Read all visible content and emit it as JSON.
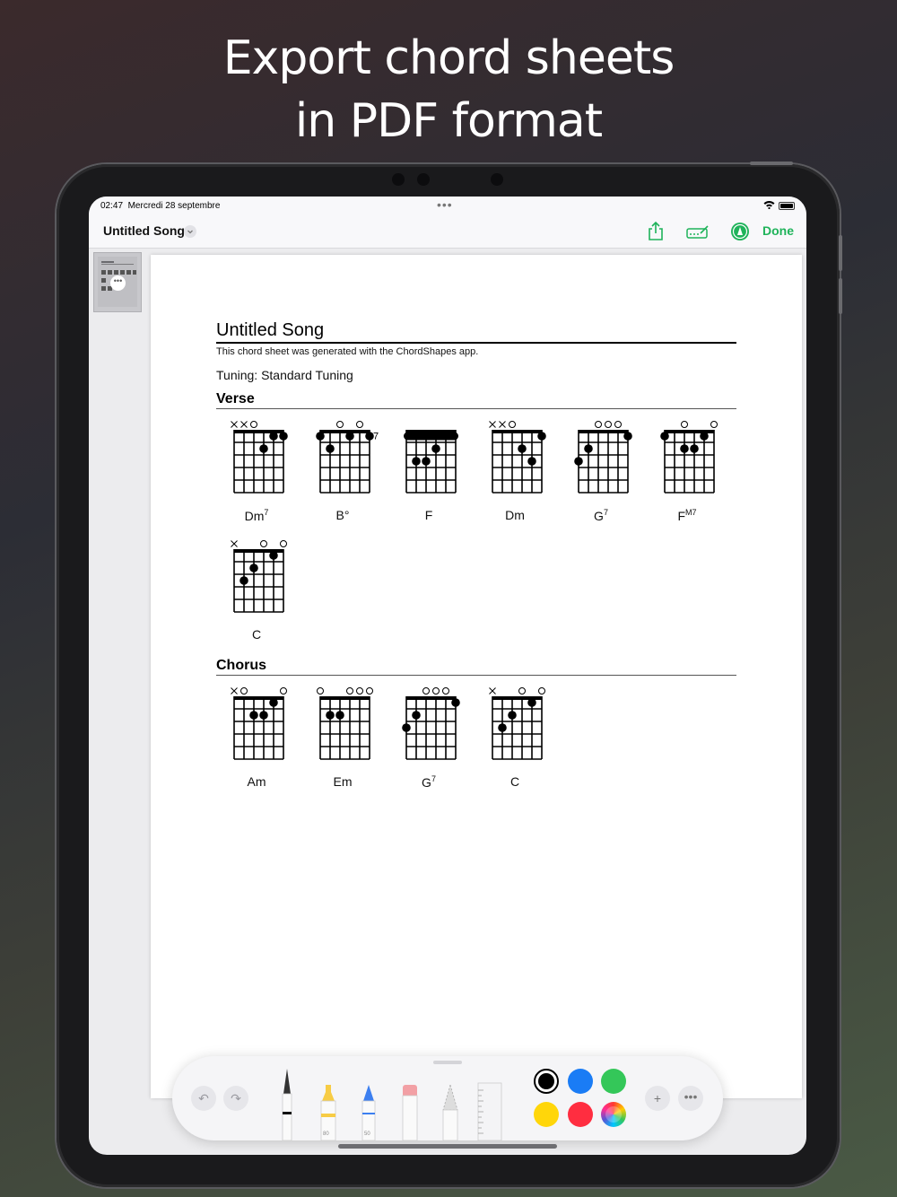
{
  "headline": {
    "line1": "Export chord sheets",
    "line2": "in PDF format"
  },
  "status_bar": {
    "time": "02:47",
    "date": "Mercredi 28 septembre"
  },
  "nav": {
    "title": "Untitled Song",
    "done_label": "Done"
  },
  "document": {
    "title": "Untitled Song",
    "subtitle": "This chord sheet was generated with the ChordShapes app.",
    "tuning": "Tuning: Standard Tuning",
    "sections": [
      {
        "label": "Verse",
        "chords": [
          {
            "base": "Dm",
            "sup": "7",
            "markers": [
              "x",
              "x",
              "o",
              "",
              "",
              ""
            ],
            "dots": [
              [
                3,
                2
              ],
              [
                4,
                1
              ],
              [
                5,
                1
              ]
            ]
          },
          {
            "base": "B°",
            "sup": "",
            "markers": [
              "",
              "",
              "o",
              "",
              "o",
              ""
            ],
            "fret_label": "7",
            "dots": [
              [
                0,
                1
              ],
              [
                1,
                2
              ],
              [
                3,
                1
              ],
              [
                5,
                1
              ]
            ]
          },
          {
            "base": "F",
            "sup": "",
            "markers": [
              "",
              "",
              "",
              "",
              "",
              ""
            ],
            "barre": 1,
            "dots": [
              [
                1,
                3
              ],
              [
                2,
                3
              ],
              [
                3,
                2
              ]
            ]
          },
          {
            "base": "Dm",
            "sup": "",
            "markers": [
              "x",
              "x",
              "o",
              "",
              "",
              ""
            ],
            "dots": [
              [
                3,
                2
              ],
              [
                4,
                3
              ],
              [
                5,
                1
              ]
            ]
          },
          {
            "base": "G",
            "sup": "7",
            "markers": [
              "",
              "",
              "o",
              "o",
              "o",
              ""
            ],
            "dots": [
              [
                0,
                3
              ],
              [
                1,
                2
              ],
              [
                5,
                1
              ]
            ]
          },
          {
            "base": "F",
            "sup": "M7",
            "markers": [
              "",
              "",
              "o",
              "",
              "",
              "o"
            ],
            "dots": [
              [
                0,
                1
              ],
              [
                2,
                2
              ],
              [
                3,
                2
              ],
              [
                4,
                1
              ]
            ]
          },
          {
            "base": "C",
            "sup": "",
            "markers": [
              "x",
              "",
              "",
              "o",
              "",
              "o"
            ],
            "dots": [
              [
                1,
                3
              ],
              [
                2,
                2
              ],
              [
                4,
                1
              ]
            ]
          }
        ]
      },
      {
        "label": "Chorus",
        "chords": [
          {
            "base": "Am",
            "sup": "",
            "markers": [
              "x",
              "o",
              "",
              "",
              "",
              "o"
            ],
            "dots": [
              [
                2,
                2
              ],
              [
                3,
                2
              ],
              [
                4,
                1
              ]
            ]
          },
          {
            "base": "Em",
            "sup": "",
            "markers": [
              "o",
              "",
              "",
              "o",
              "o",
              "o"
            ],
            "dots": [
              [
                1,
                2
              ],
              [
                2,
                2
              ]
            ]
          },
          {
            "base": "G",
            "sup": "7",
            "markers": [
              "",
              "",
              "o",
              "o",
              "o",
              ""
            ],
            "dots": [
              [
                0,
                3
              ],
              [
                1,
                2
              ],
              [
                5,
                1
              ]
            ]
          },
          {
            "base": "C",
            "sup": "",
            "markers": [
              "x",
              "",
              "",
              "o",
              "",
              "o"
            ],
            "dots": [
              [
                1,
                3
              ],
              [
                2,
                2
              ],
              [
                4,
                1
              ]
            ]
          }
        ]
      }
    ]
  },
  "toolbar": {
    "tool_labels": {
      "marker_size": "80",
      "pencil_size": "50"
    },
    "colors": [
      "#000000",
      "#1a7cf5",
      "#34c759",
      "#ffd60a",
      "#ff2d40"
    ]
  }
}
